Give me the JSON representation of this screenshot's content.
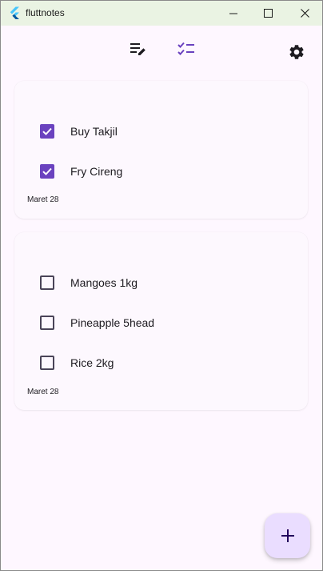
{
  "window": {
    "title": "fluttnotes"
  },
  "toolbar": {
    "icons": [
      "notes-edit-icon",
      "checklist-icon",
      "gear-icon"
    ],
    "active_color": "#6a42bf"
  },
  "notes": [
    {
      "items": [
        {
          "label": "Buy Takjil",
          "checked": true
        },
        {
          "label": "Fry Cireng",
          "checked": true
        }
      ],
      "date": "Maret 28"
    },
    {
      "items": [
        {
          "label": "Mangoes 1kg",
          "checked": false
        },
        {
          "label": "Pineapple 5head",
          "checked": false
        },
        {
          "label": "Rice 2kg",
          "checked": false
        }
      ],
      "date": "Maret 28"
    }
  ],
  "fab": {
    "icon": "plus-icon",
    "color": "#eaddff"
  },
  "colors": {
    "background": "#fef7ff",
    "titlebar": "#eaf3e3",
    "checkbox_checked": "#6a42bf"
  }
}
